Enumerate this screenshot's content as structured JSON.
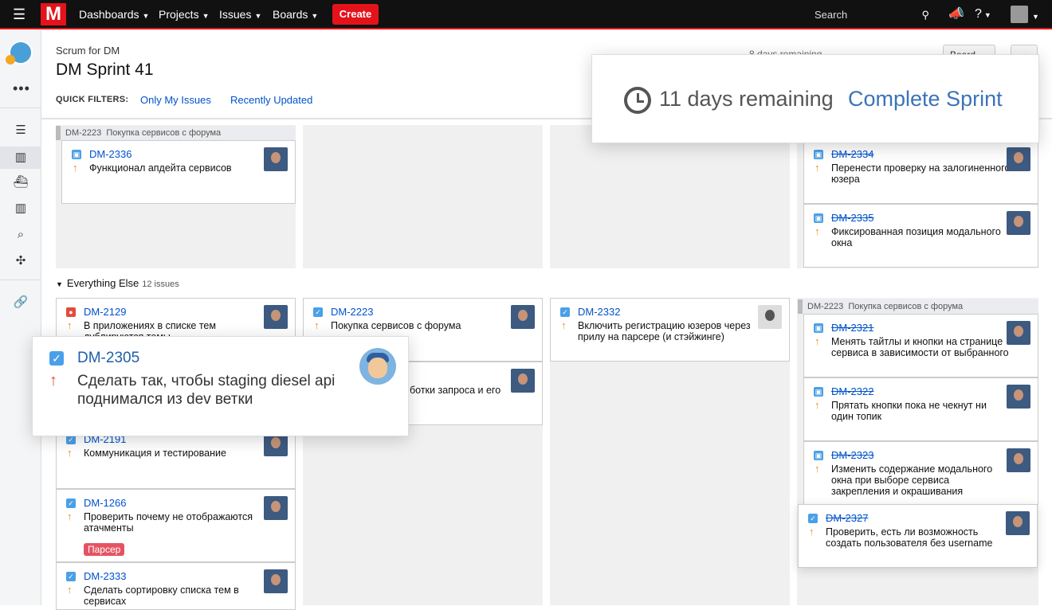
{
  "topbar": {
    "menu_icon": "hamburger-icon",
    "logo_letter": "M",
    "nav": [
      "Dashboards",
      "Projects",
      "Issues",
      "Boards"
    ],
    "create": "Create",
    "search_placeholder": "Search",
    "icons": [
      "search-icon",
      "megaphone-icon",
      "help-icon",
      "avatar"
    ]
  },
  "sidebar": {
    "icons": [
      "backlog-icon",
      "board-icon",
      "releases-icon",
      "reports-icon",
      "issues-search-icon",
      "components-icon",
      "link-icon"
    ],
    "more": "•••"
  },
  "header": {
    "breadcrumb": "Scrum for DM",
    "title": "DM Sprint 41",
    "quick_filters_label": "QUICK FILTERS:",
    "quick_filters": [
      "Only My Issues",
      "Recently Updated"
    ],
    "days_remaining_bg": "8 days remaining",
    "complete_sprint_bg": "Complete Sprint",
    "board_button": "Board"
  },
  "sprint_popup": {
    "days_remaining": "11 days remaining",
    "complete_sprint": "Complete Sprint"
  },
  "swimlane_top": {
    "parent_key": "DM-2223",
    "parent_summary": "Покупка сервисов с форума",
    "todo": [
      {
        "key": "DM-2336",
        "summary": "Функционал апдейта сервисов"
      }
    ],
    "done": [
      {
        "key": "DM-2334",
        "summary": "Перенести проверку на залогиненного юзера"
      },
      {
        "key": "DM-2335",
        "summary": "Фиксированная позиция модального окна"
      }
    ]
  },
  "swimlane_else": {
    "label": "Everything Else",
    "count": "12 issues",
    "todo": [
      {
        "key": "DM-2129",
        "summary": "В приложениях в списке тем дублируются темы"
      },
      {
        "key": "DM-2191",
        "summary": "Коммуникация и тестирование"
      },
      {
        "key": "DM-1266",
        "summary": "Проверить почему не отображаются атачменты",
        "label": "Парсер"
      },
      {
        "key": "DM-2333",
        "summary": "Сделать сортировку списка тем в сервисах"
      }
    ],
    "in_progress": [
      {
        "key": "DM-2223",
        "summary": "Покупка сервисов с форума"
      },
      {
        "key": "",
        "summary": "ботки запроса и его"
      }
    ],
    "review": [
      {
        "key": "DM-2332",
        "summary": "Включить регистрацию юзеров через прилу на парсере (и стэйжинге)"
      }
    ],
    "done_parent_key": "DM-2223",
    "done_parent_summary": "Покупка сервисов с форума",
    "done": [
      {
        "key": "DM-2321",
        "summary": "Менять тайтлы и кнопки на странице сервиса в зависимости от выбранного"
      },
      {
        "key": "DM-2322",
        "summary": "Прятать кнопки пока не чекнут ни один топик"
      },
      {
        "key": "DM-2323",
        "summary": "Изменить содержание модального окна при выборе сервиса закрепления и окрашивания"
      },
      {
        "key": "DM-2327",
        "summary": "Проверить, есть ли возможность создать пользователя без username"
      }
    ]
  },
  "issue_popup": {
    "key": "DM-2305",
    "summary": "Сделать так, чтобы staging diesel api поднимался из dev ветки"
  }
}
